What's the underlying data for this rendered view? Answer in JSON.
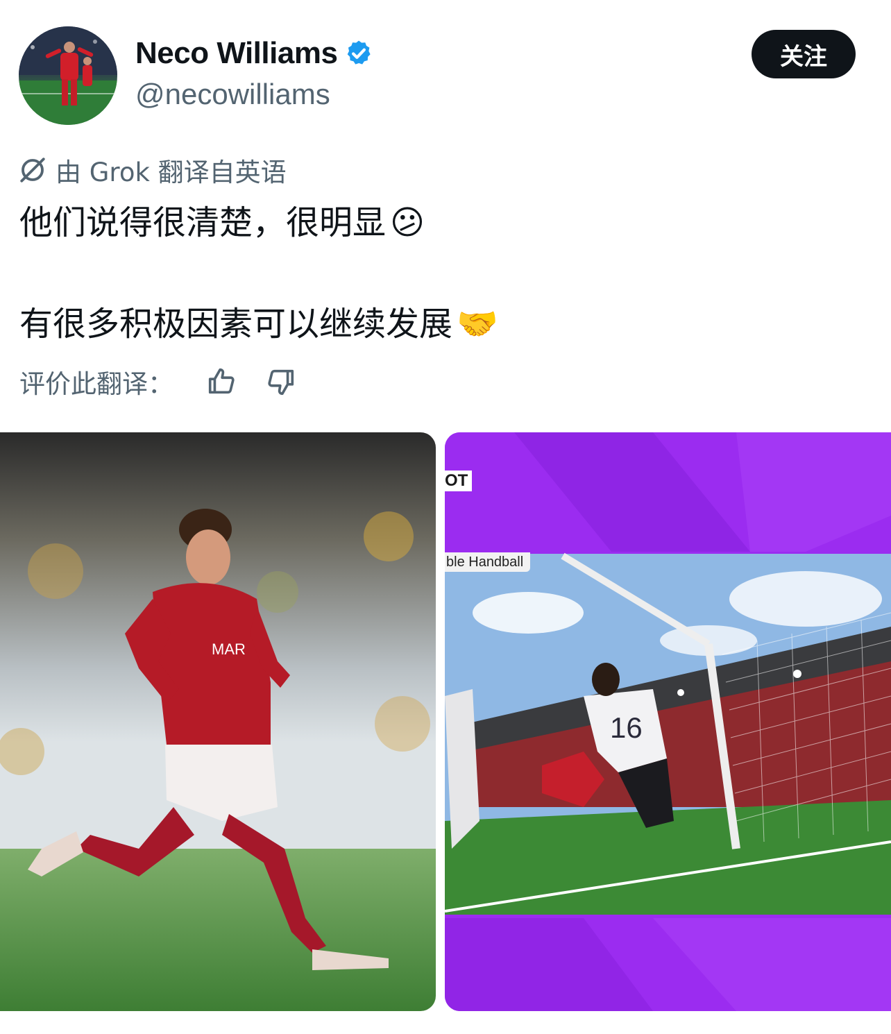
{
  "profile": {
    "display_name": "Neco Williams",
    "handle": "@necowilliams",
    "verified": true,
    "avatar_icon": "avatar-photo",
    "follow_label": "关注"
  },
  "translation": {
    "icon": "grok-icon",
    "label": "由 Grok 翻译自英语"
  },
  "tweet": {
    "line1": "他们说得很清楚，很明显",
    "emoji1": "😕",
    "line2": "有很多积极因素可以继续发展",
    "emoji2": "🤝"
  },
  "rating": {
    "label": "评价此翻译：",
    "thumbs_up_icon": "thumbs-up-icon",
    "thumbs_down_icon": "thumbs-down-icon"
  },
  "media": {
    "overlay_tag": "OT",
    "overlay_label": "ble Handball",
    "jersey_number": "16"
  },
  "colors": {
    "follow_bg": "#0f1419",
    "verified": "#1d9bf0",
    "secondary_text": "#536471",
    "broadcast_purple": "#9b2cf0"
  }
}
